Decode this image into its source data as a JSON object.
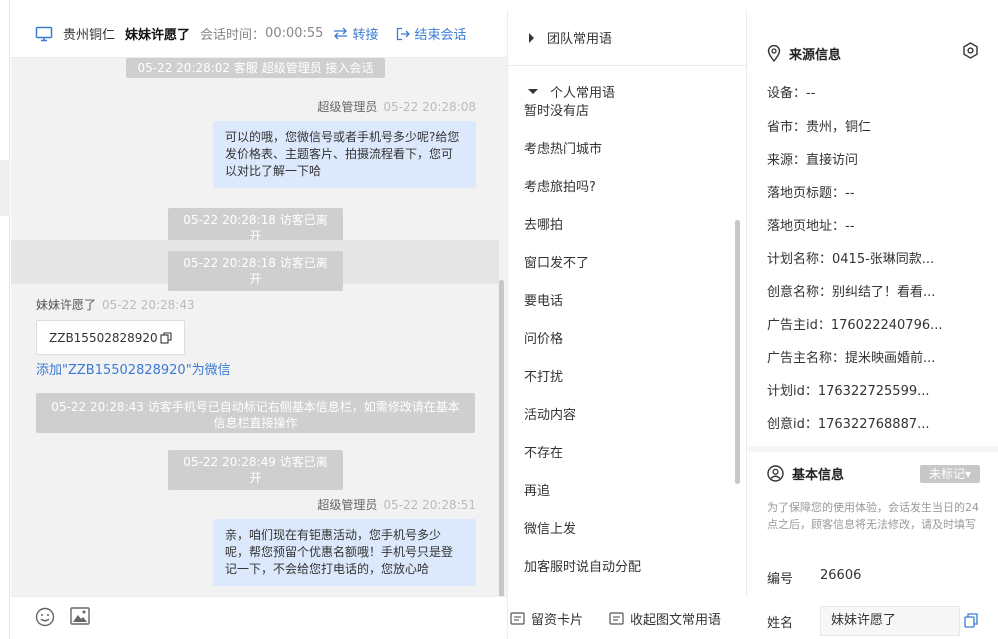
{
  "header": {
    "location": "贵州铜仁",
    "visitor_name": "妹妹许愿了",
    "time_label": "会话时间：",
    "time_value": "00:00:55",
    "transfer_label": "转接",
    "end_label": "结束会话"
  },
  "messages": {
    "sys1": "05-22 20:28:02 客服 超级管理员 接入会话",
    "agent1_name": "超级管理员",
    "agent1_time": "05-22 20:28:08",
    "agent1_text": "可以的哦，您微信号或者手机号多少呢?给您发价格表、主题客片、拍摄流程看下，您可以对比了解一下哈",
    "sys2": "05-22 20:28:18 访客已离开",
    "sys3": "05-22 20:28:18 访客已离开",
    "visitor_name": "妹妹许愿了",
    "visitor_time": "05-22 20:28:43",
    "visitor_text": "ZZB15502828920",
    "add_wechat": "添加\"ZZB15502828920\"为微信",
    "sys4": "05-22 20:28:43 访客手机号已自动标记右侧基本信息栏，如需修改请在基本信息栏直接操作",
    "sys5": "05-22 20:28:49 访客已离开",
    "agent2_name": "超级管理员",
    "agent2_time": "05-22 20:28:51",
    "agent2_text": "亲，咱们现在有钜惠活动，您手机号多少呢，帮您预留个优惠名额哦！手机号只是登记一下，不会给您打电话的，您放心哈"
  },
  "phrases": {
    "team_label": "团队常用语",
    "personal_label": "个人常用语",
    "items": [
      "暂时没有店",
      "考虑热门城市",
      "考虑旅拍吗?",
      "去哪拍",
      "窗口发不了",
      "要电话",
      "问价格",
      "不打扰",
      "活动内容",
      "不存在",
      "再追",
      "微信上发",
      "加客服时说自动分配"
    ],
    "card_label": "留资卡片",
    "collapse_label": "收起图文常用语"
  },
  "source": {
    "title": "来源信息",
    "rows": [
      "设备：--",
      "省市：贵州，铜仁",
      "来源：直接访问",
      "落地页标题：--",
      "落地页地址：--",
      "计划名称：0415-张琳同款...",
      "创意名称：别纠结了！看看...",
      "广告主id：176022240796...",
      "广告主名称：提米映画婚前...",
      "计划id：176322725599...",
      "创意id：176322768887..."
    ]
  },
  "basic": {
    "title": "基本信息",
    "badge": "未标记▾",
    "note": "为了保障您的使用体验，会话发生当日的24点之后，顾客信息将无法修改，请及时填写",
    "id_label": "编号",
    "id_value": "26606",
    "name_label": "姓名",
    "name_value": "妹妹许愿了"
  },
  "colors": {
    "accent": "#3a7bd5",
    "agent_bubble": "#dce8fb",
    "system_pill": "#cfcfcf"
  }
}
